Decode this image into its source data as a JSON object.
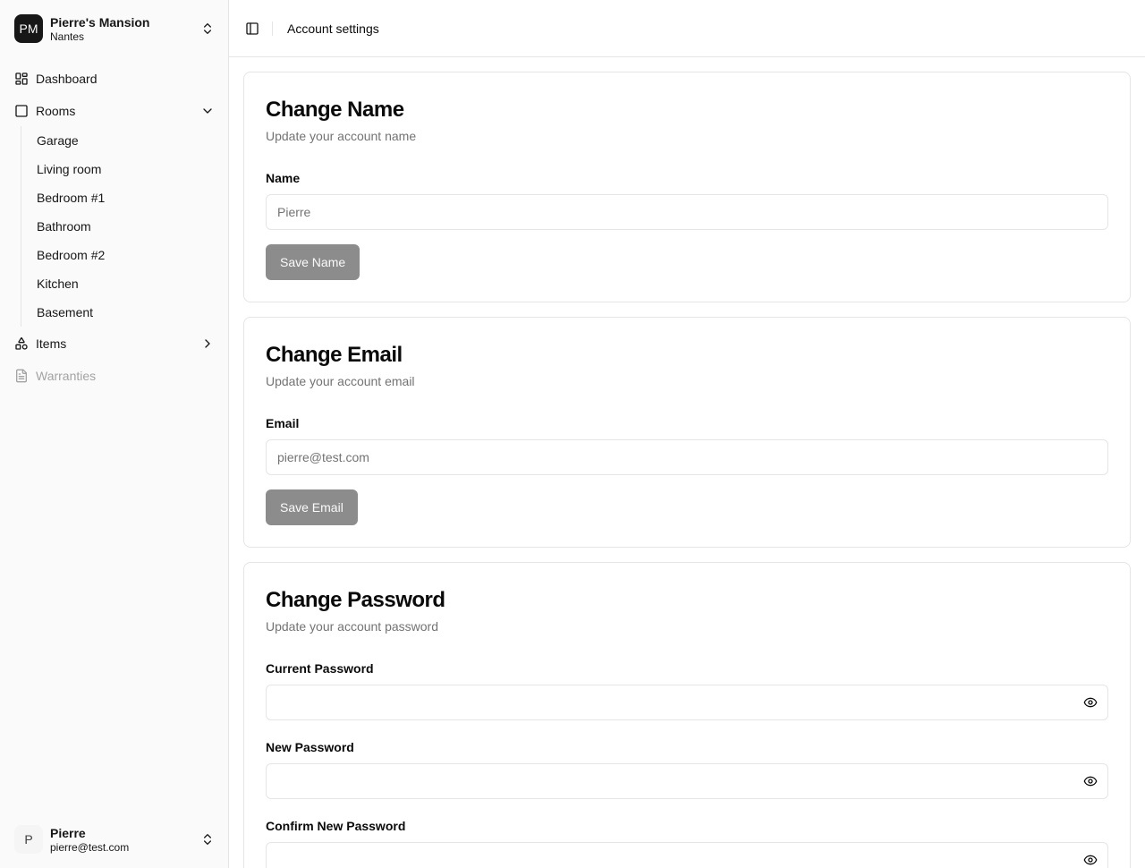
{
  "sidebar": {
    "org": {
      "initials": "PM",
      "name": "Pierre's Mansion",
      "city": "Nantes"
    },
    "nav": {
      "dashboard": "Dashboard",
      "rooms": "Rooms",
      "items": "Items",
      "warranties": "Warranties"
    },
    "rooms": [
      "Garage",
      "Living room",
      "Bedroom #1",
      "Bathroom",
      "Bedroom #2",
      "Kitchen",
      "Basement"
    ],
    "user": {
      "initial": "P",
      "name": "Pierre",
      "email": "pierre@test.com"
    }
  },
  "header": {
    "title": "Account settings"
  },
  "name_card": {
    "title": "Change Name",
    "description": "Update your account name",
    "label": "Name",
    "placeholder": "Pierre",
    "button": "Save Name"
  },
  "email_card": {
    "title": "Change Email",
    "description": "Update your account email",
    "label": "Email",
    "placeholder": "pierre@test.com",
    "button": "Save Email"
  },
  "password_card": {
    "title": "Change Password",
    "description": "Update your account password",
    "current_label": "Current Password",
    "new_label": "New Password",
    "confirm_label": "Confirm New Password"
  },
  "icons": {
    "org_switcher": "chevrons-up-down-icon",
    "dashboard": "layout-dashboard-icon",
    "rooms": "square-icon",
    "items": "shapes-icon",
    "warranties": "file-text-icon",
    "sidebar_toggle": "panel-left-icon",
    "password_visibility": "eye-icon"
  },
  "colors": {
    "sidebar_bg": "#fafafa",
    "primary": "#171717",
    "button_disabled": "#8c8c8c",
    "muted_text": "#737373",
    "border": "#e5e5e5"
  }
}
